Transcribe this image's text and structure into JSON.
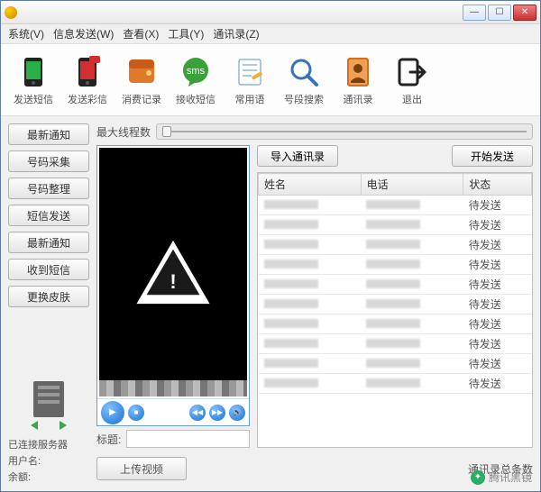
{
  "menubar": {
    "items": [
      "系统(V)",
      "信息发送(W)",
      "查看(X)",
      "工具(Y)",
      "通讯录(Z)"
    ]
  },
  "toolbar": {
    "items": [
      {
        "label": "发送短信",
        "icon": "phone-green"
      },
      {
        "label": "发送彩信",
        "icon": "phone-red"
      },
      {
        "label": "消费记录",
        "icon": "wallet"
      },
      {
        "label": "接收短信",
        "icon": "sms-bubble"
      },
      {
        "label": "常用语",
        "icon": "notepad"
      },
      {
        "label": "号段搜索",
        "icon": "magnifier"
      },
      {
        "label": "通讯录",
        "icon": "contact-book"
      },
      {
        "label": "退出",
        "icon": "exit"
      }
    ]
  },
  "sidebar": {
    "buttons": [
      "最新通知",
      "号码采集",
      "号码整理",
      "短信发送",
      "最新通知",
      "收到短信",
      "更换皮肤"
    ]
  },
  "server": {
    "status": "已连接服务器",
    "user_label": "用户名:",
    "balance_label": "余额:"
  },
  "threads": {
    "label": "最大线程数"
  },
  "actions": {
    "import": "导入通讯录",
    "start": "开始发送",
    "upload": "上传视频",
    "title_label": "标题:"
  },
  "table": {
    "headers": [
      "姓名",
      "电话",
      "状态"
    ],
    "rows": [
      {
        "status": "待发送"
      },
      {
        "status": "待发送"
      },
      {
        "status": "待发送"
      },
      {
        "status": "待发送"
      },
      {
        "status": "待发送"
      },
      {
        "status": "待发送"
      },
      {
        "status": "待发送"
      },
      {
        "status": "待发送"
      },
      {
        "status": "待发送"
      },
      {
        "status": "待发送"
      }
    ],
    "total_label": "通讯录总条数"
  },
  "watermark": {
    "text": "腾讯黑镜"
  }
}
